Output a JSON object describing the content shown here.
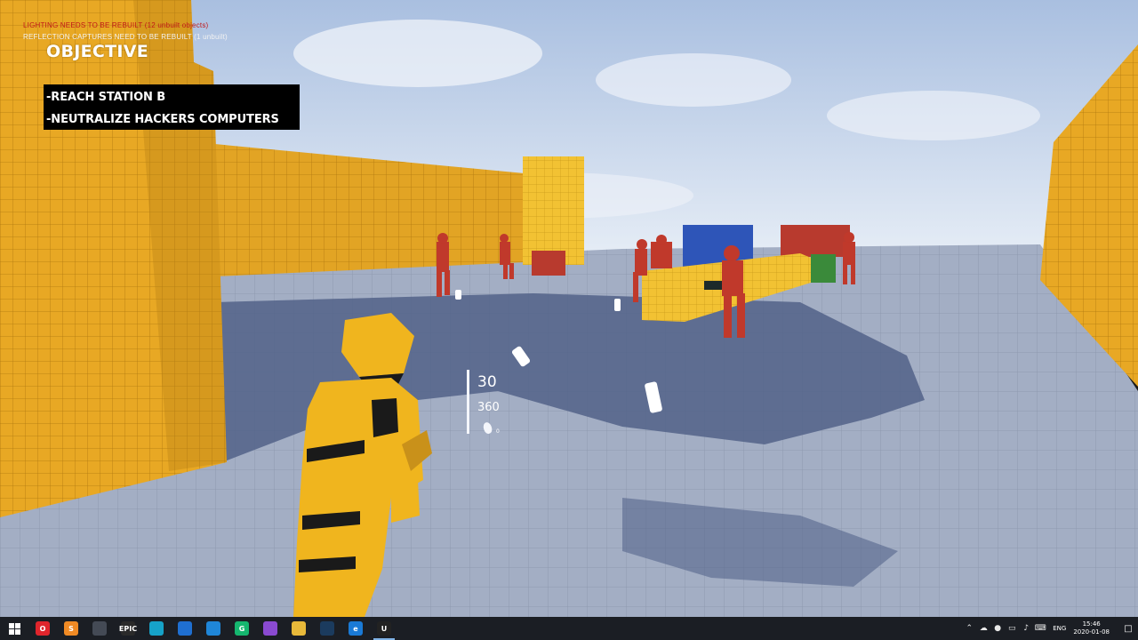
{
  "window": {
    "debug_lighting": "LIGHTING NEEDS TO BE REBUILT (12 unbuilt objects)",
    "debug_reflection": "REFLECTION CAPTURES NEED TO BE REBUILT (1 unbuilt)"
  },
  "hud": {
    "objective_title": "OBJECTIVE",
    "objectives": [
      "-REACH STATION B",
      "-NEUTRALIZE HACKERS COMPUTERS"
    ],
    "ammo_magazine": "30",
    "ammo_reserve": "360",
    "grenade_count": "0",
    "magazine_fill_fraction": 1.0
  },
  "scene": {
    "colors": {
      "sky_top": "#a9bfe0",
      "sky_horizon": "#e6edf6",
      "floor": "#a3aec4",
      "floor_shadow": "#4f5f86",
      "wall_yellow": "#e8a824",
      "wall_yellow_dark": "#b47d14",
      "cube_yellow": "#f2c233",
      "enemy_red": "#c0392b",
      "player_yellow": "#f0b51e",
      "crate_blue": "#2e55b8",
      "crate_red": "#b83a2e",
      "crate_green": "#3a8a3a"
    }
  },
  "taskbar": {
    "apps": [
      {
        "name": "start",
        "icon": "windows-icon",
        "label": ""
      },
      {
        "name": "opera",
        "icon": "opera-icon",
        "label": "O",
        "color": "#e0252c"
      },
      {
        "name": "sublime",
        "icon": "sublime-icon",
        "label": "S",
        "color": "#f08a24"
      },
      {
        "name": "explorer-window",
        "icon": "display-icon",
        "label": "",
        "color": "#444a55"
      },
      {
        "name": "epic",
        "icon": "epic-games-icon",
        "label": "EPIC",
        "color": "#2a2a2a"
      },
      {
        "name": "shield",
        "icon": "shield-icon",
        "label": "",
        "color": "#16a2c8"
      },
      {
        "name": "maps",
        "icon": "map-pin-icon",
        "label": "",
        "color": "#1f6fd1"
      },
      {
        "name": "vscode",
        "icon": "vscode-icon",
        "label": "",
        "color": "#1f86d8"
      },
      {
        "name": "grammarly",
        "icon": "grammarly-icon",
        "label": "G",
        "color": "#15b66f"
      },
      {
        "name": "snip",
        "icon": "snip-icon",
        "label": "",
        "color": "#8a4ad1"
      },
      {
        "name": "files",
        "icon": "folder-icon",
        "label": "",
        "color": "#e8b93a"
      },
      {
        "name": "steam",
        "icon": "steam-icon",
        "label": "",
        "color": "#1b3b5e"
      },
      {
        "name": "edge",
        "icon": "edge-icon",
        "label": "e",
        "color": "#1a7ad6"
      },
      {
        "name": "unreal",
        "icon": "unreal-icon",
        "label": "U",
        "color": "#222222"
      }
    ],
    "active_index": 13,
    "language": "ENG",
    "time": "15:46",
    "date": "2020-01-08"
  }
}
